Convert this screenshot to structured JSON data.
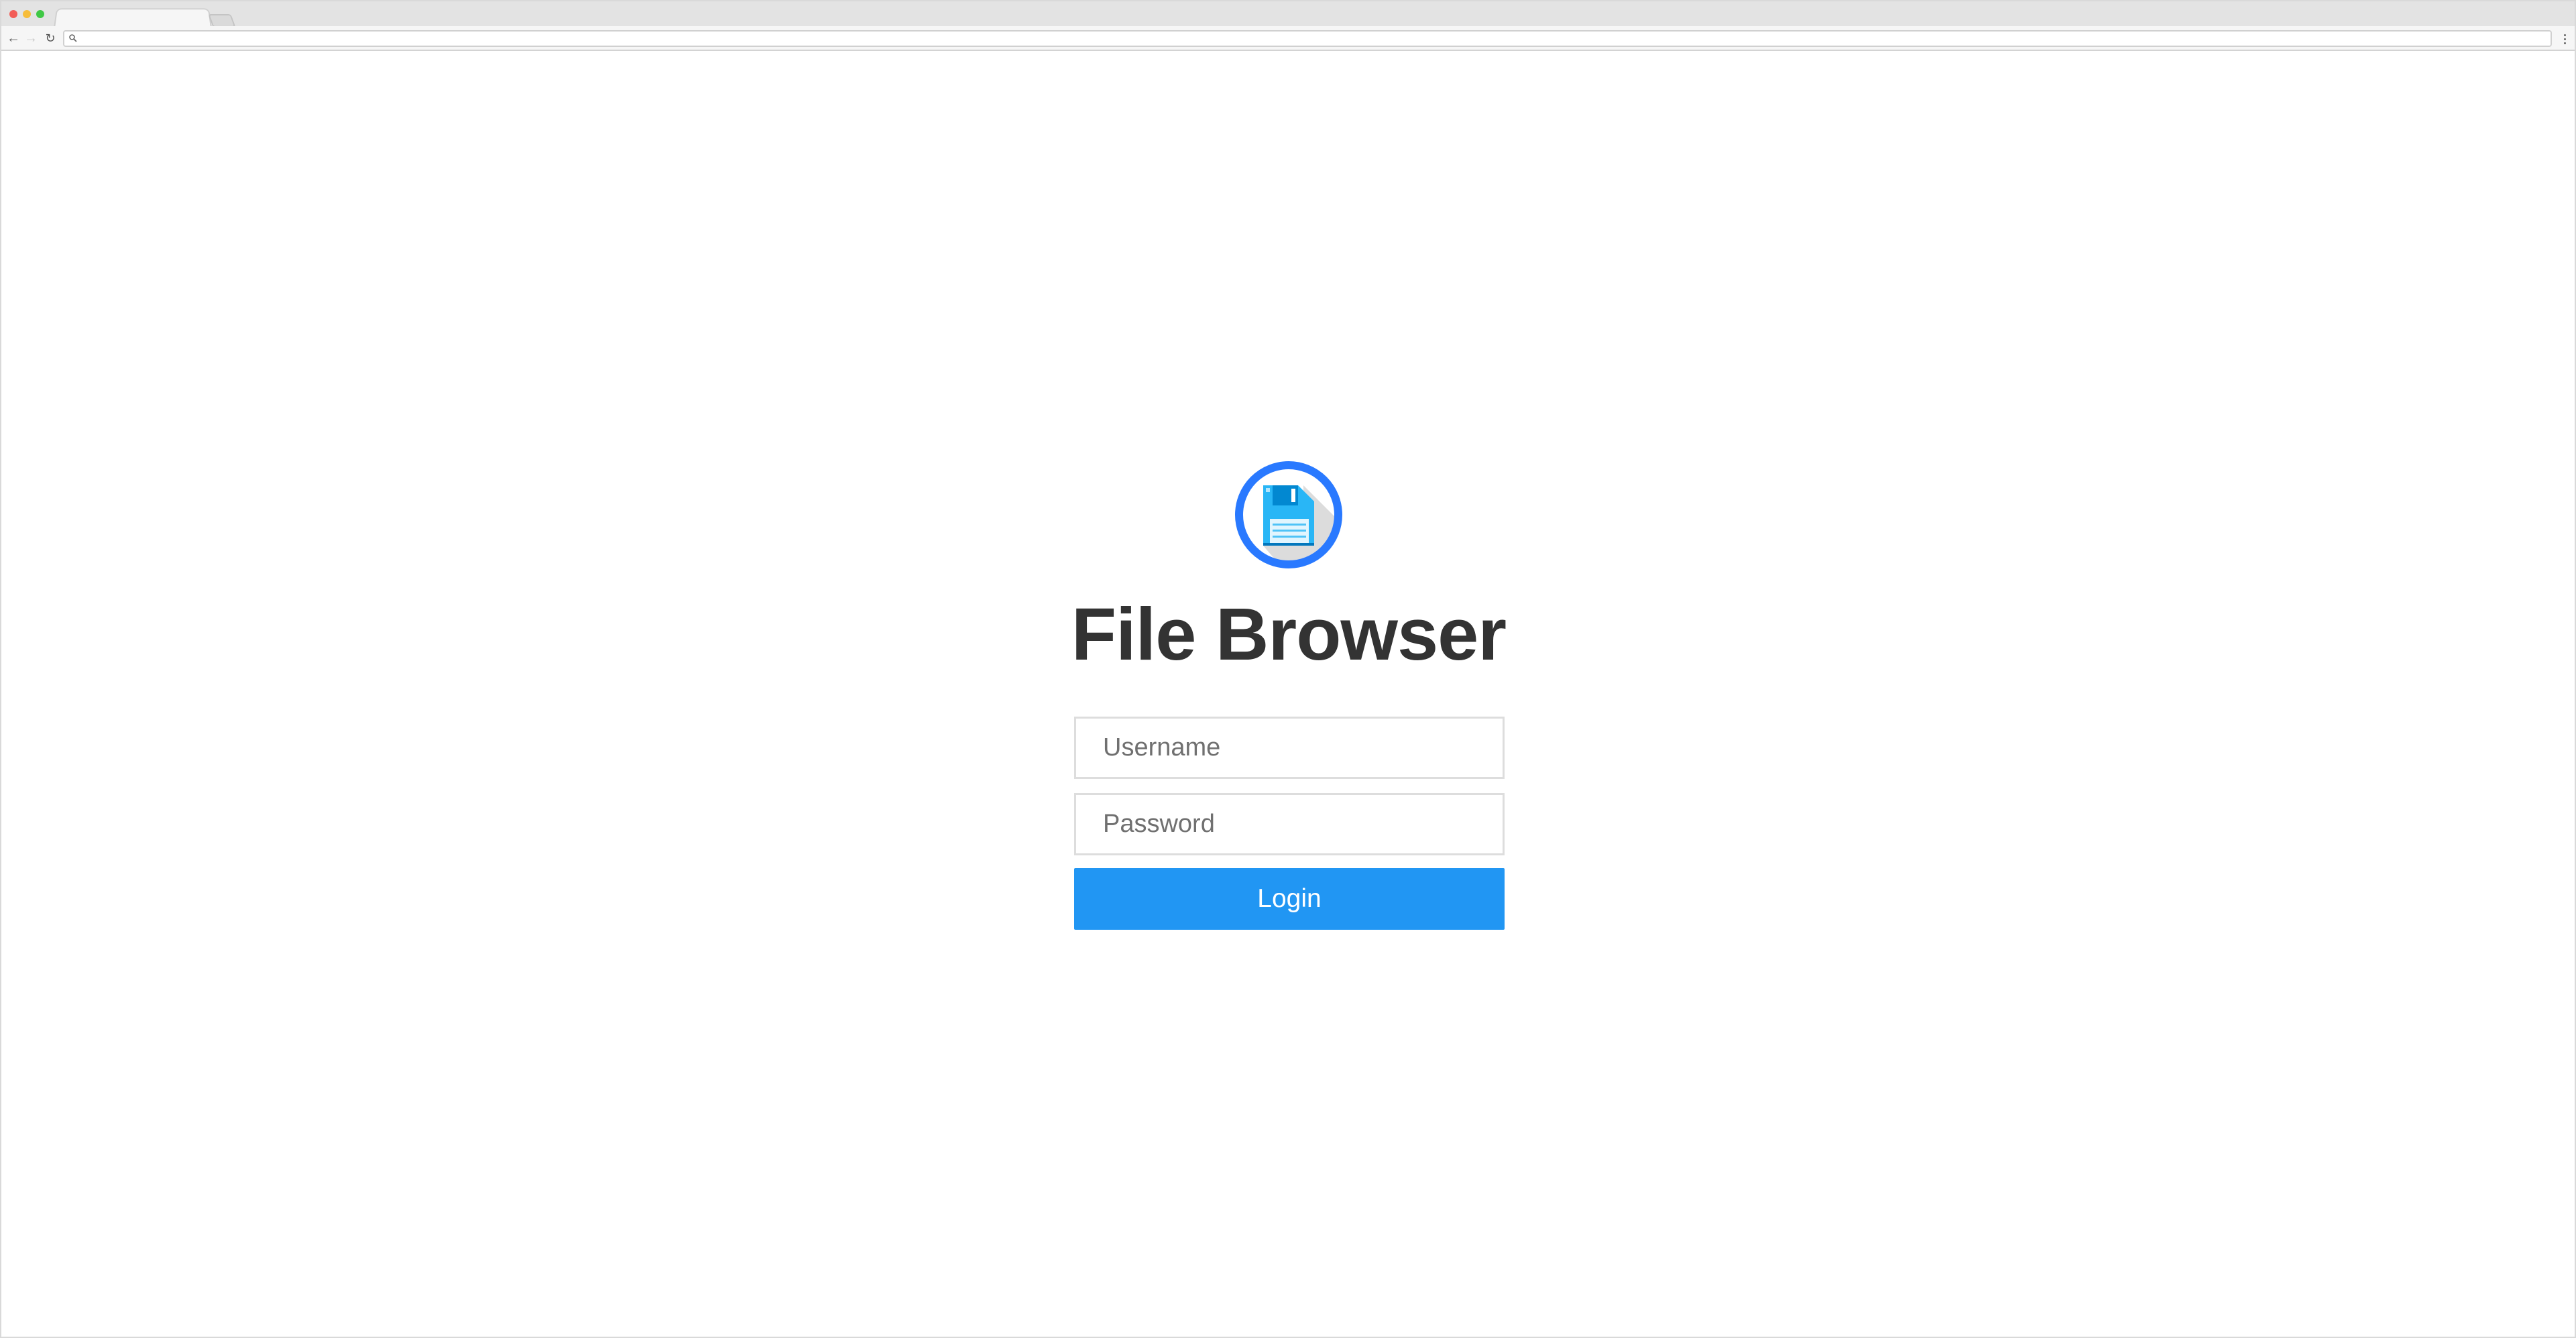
{
  "login": {
    "app_title": "File Browser",
    "username_placeholder": "Username",
    "password_placeholder": "Password",
    "login_label": "Login"
  },
  "colors": {
    "accent": "#2196f3",
    "logo_ring": "#2979ff",
    "title_text": "#333333"
  },
  "icons": {
    "logo": "floppy-disk-icon",
    "back": "back-arrow-icon",
    "forward": "forward-arrow-icon",
    "reload": "reload-icon",
    "search": "search-icon",
    "menu": "kebab-menu-icon"
  }
}
